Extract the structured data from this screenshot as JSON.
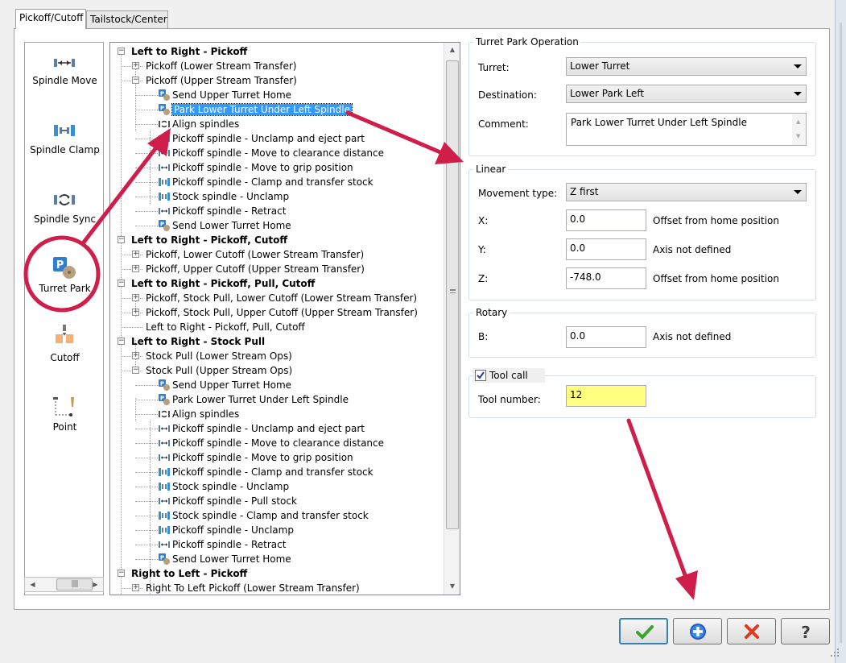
{
  "tabs": [
    {
      "label": "Pickoff/Cutoff"
    },
    {
      "label": "Tailstock/Center"
    }
  ],
  "palette": {
    "items": [
      {
        "label": "Spindle Move",
        "icon": "spindle-move-icon"
      },
      {
        "label": "Spindle Clamp",
        "icon": "spindle-clamp-icon"
      },
      {
        "label": "Spindle Sync",
        "icon": "spindle-sync-icon"
      },
      {
        "label": "Turret Park",
        "icon": "turret-park-icon"
      },
      {
        "label": "Cutoff",
        "icon": "cutoff-icon"
      },
      {
        "label": "Point",
        "icon": "point-icon"
      }
    ]
  },
  "tree": {
    "rows": [
      {
        "level": 0,
        "text": "Left to Right - Pickoff",
        "bold": true,
        "toggle": "-"
      },
      {
        "level": 1,
        "text": "Pickoff (Lower Stream Transfer)",
        "toggle": "+"
      },
      {
        "level": 1,
        "text": "Pickoff (Upper Stream Transfer)",
        "toggle": "-"
      },
      {
        "level": 2,
        "text": "Send Upper Turret Home",
        "icon": "park"
      },
      {
        "level": 2,
        "text": "Park Lower Turret Under Left Spindle",
        "icon": "park",
        "selected": true
      },
      {
        "level": 2,
        "text": "Align spindles",
        "icon": "sync"
      },
      {
        "level": 2,
        "text": "Pickoff spindle - Unclamp and eject part",
        "icon": "move"
      },
      {
        "level": 2,
        "text": "Pickoff spindle - Move to clearance distance",
        "icon": "move"
      },
      {
        "level": 2,
        "text": "Pickoff spindle - Move to grip position",
        "icon": "move"
      },
      {
        "level": 2,
        "text": "Pickoff spindle - Clamp and transfer stock",
        "icon": "clamp"
      },
      {
        "level": 2,
        "text": "Stock spindle - Unclamp",
        "icon": "clamp"
      },
      {
        "level": 2,
        "text": "Pickoff spindle - Retract",
        "icon": "move"
      },
      {
        "level": 2,
        "text": "Send Lower Turret Home",
        "icon": "park"
      },
      {
        "level": 0,
        "text": "Left to Right - Pickoff, Cutoff",
        "bold": true,
        "toggle": "-"
      },
      {
        "level": 1,
        "text": "Pickoff, Lower Cutoff (Lower Stream Transfer)",
        "toggle": "+"
      },
      {
        "level": 1,
        "text": "Pickoff, Upper Cutoff (Upper Stream Transfer)",
        "toggle": "+"
      },
      {
        "level": 0,
        "text": "Left to Right - Pickoff, Pull, Cutoff",
        "bold": true,
        "toggle": "-"
      },
      {
        "level": 1,
        "text": "Pickoff, Stock Pull, Lower Cutoff (Lower Stream Transfer)",
        "toggle": "+"
      },
      {
        "level": 1,
        "text": "Pickoff, Stock Pull, Upper Cutoff (Upper Stream Transfer)",
        "toggle": "+"
      },
      {
        "level": 1,
        "text": "Left to Right - Pickoff, Pull, Cutoff"
      },
      {
        "level": 0,
        "text": "Left to Right - Stock Pull",
        "bold": true,
        "toggle": "-"
      },
      {
        "level": 1,
        "text": "Stock Pull (Lower Stream Ops)",
        "toggle": "+"
      },
      {
        "level": 1,
        "text": "Stock Pull (Upper Stream Ops)",
        "toggle": "-"
      },
      {
        "level": 2,
        "text": "Send Upper Turret Home",
        "icon": "park"
      },
      {
        "level": 2,
        "text": "Park Lower Turret Under Left Spindle",
        "icon": "park"
      },
      {
        "level": 2,
        "text": "Align spindles",
        "icon": "sync"
      },
      {
        "level": 2,
        "text": "Pickoff spindle - Unclamp and eject part",
        "icon": "move"
      },
      {
        "level": 2,
        "text": "Pickoff spindle - Move to clearance distance",
        "icon": "move"
      },
      {
        "level": 2,
        "text": "Pickoff spindle - Move to grip position",
        "icon": "move"
      },
      {
        "level": 2,
        "text": "Pickoff spindle - Clamp and transfer stock",
        "icon": "clamp"
      },
      {
        "level": 2,
        "text": "Stock spindle - Unclamp",
        "icon": "clamp"
      },
      {
        "level": 2,
        "text": "Pickoff spindle - Pull stock",
        "icon": "move"
      },
      {
        "level": 2,
        "text": "Stock spindle - Clamp and transfer stock",
        "icon": "clamp"
      },
      {
        "level": 2,
        "text": "Pickoff spindle - Unclamp",
        "icon": "clamp"
      },
      {
        "level": 2,
        "text": "Pickoff spindle - Retract",
        "icon": "move"
      },
      {
        "level": 2,
        "text": "Send Lower Turret Home",
        "icon": "park"
      },
      {
        "level": 0,
        "text": "Right to Left - Pickoff",
        "bold": true,
        "toggle": "-"
      },
      {
        "level": 1,
        "text": "Right To Left Pickoff (Lower Stream Transfer)",
        "toggle": "+"
      }
    ]
  },
  "turret_park": {
    "title": "Turret Park Operation",
    "turret_label": "Turret:",
    "turret_value": "Lower Turret",
    "destination_label": "Destination:",
    "destination_value": "Lower Park Left",
    "comment_label": "Comment:",
    "comment_value": "Park Lower Turret Under Left Spindle"
  },
  "linear": {
    "title": "Linear",
    "movement_label": "Movement type:",
    "movement_value": "Z first",
    "x_label": "X:",
    "x_value": "0.0",
    "x_note": "Offset from home position",
    "y_label": "Y:",
    "y_value": "0.0",
    "y_note": "Axis not defined",
    "z_label": "Z:",
    "z_value": "-748.0",
    "z_note": "Offset from home position"
  },
  "rotary": {
    "title": "Rotary",
    "b_label": "B:",
    "b_value": "0.0",
    "b_note": "Axis not defined"
  },
  "tool_call": {
    "title": "Tool call",
    "checked": true,
    "number_label": "Tool number:",
    "number_value": "12"
  },
  "buttons": [
    {
      "name": "ok-button",
      "icon": "checkmark-icon"
    },
    {
      "name": "add-button",
      "icon": "plus-circle-icon"
    },
    {
      "name": "cancel-button",
      "icon": "x-icon"
    },
    {
      "name": "help-button",
      "icon": "question-icon"
    }
  ],
  "colors": {
    "annotation": "#d01e4b",
    "selection": "#3399ff",
    "tool_number_bg": "#ffff80"
  }
}
